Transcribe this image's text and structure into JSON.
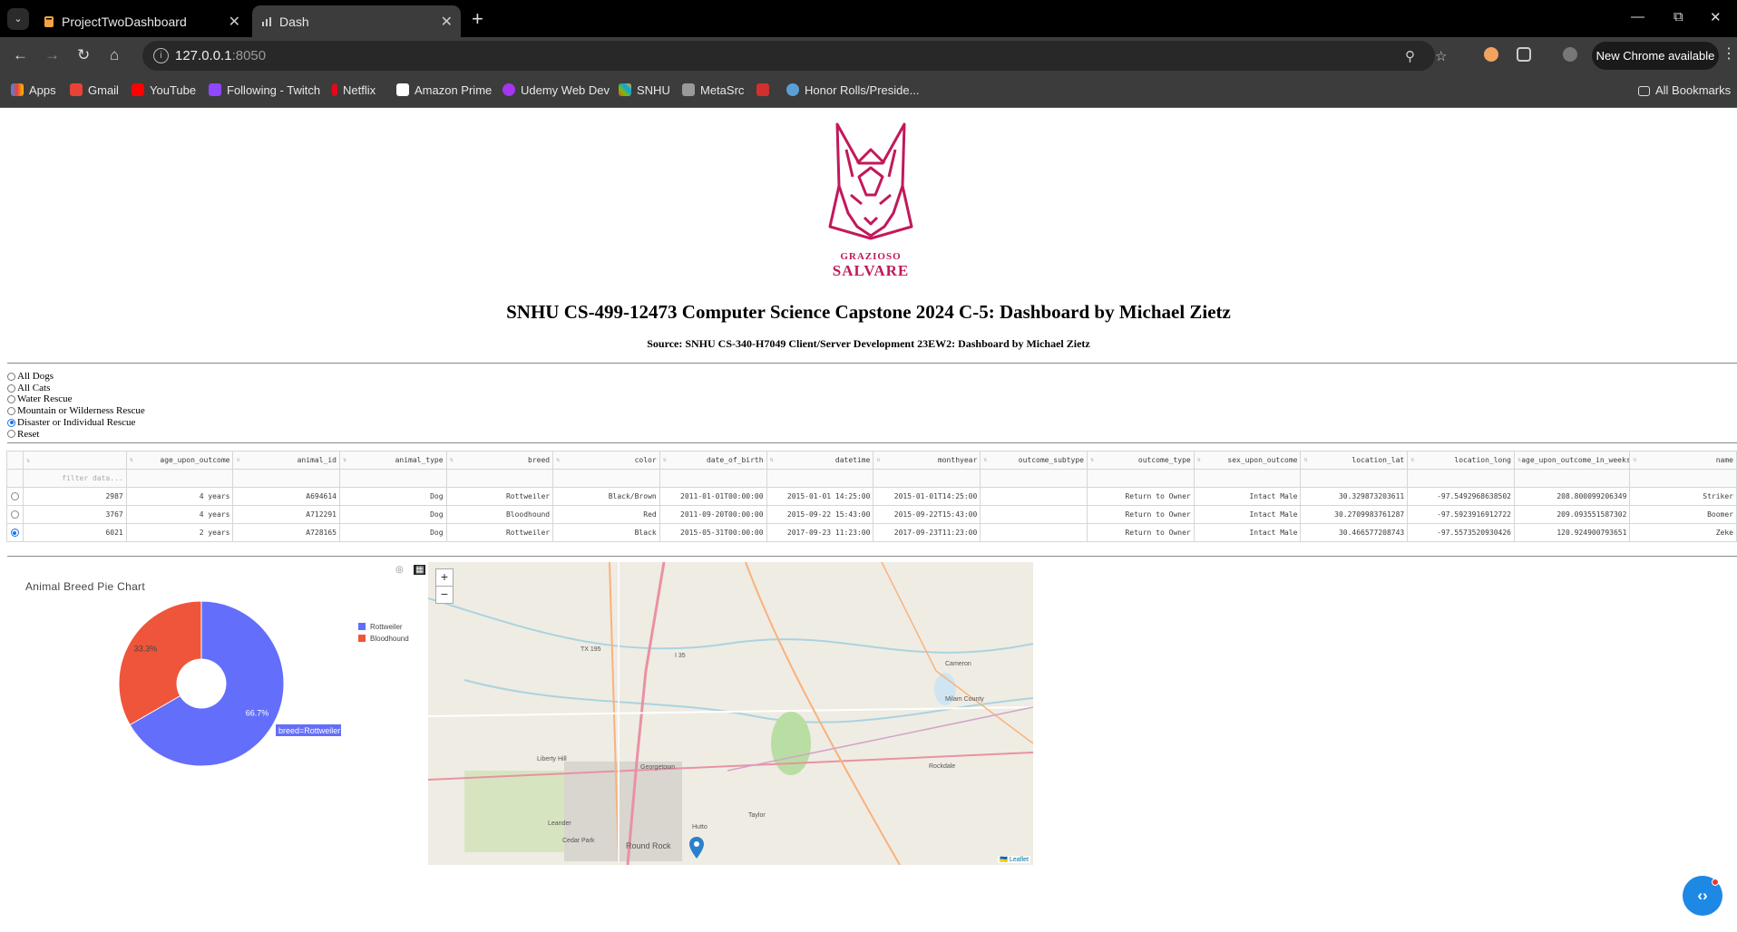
{
  "browser": {
    "tabs": [
      {
        "title": "ProjectTwoDashboard",
        "active": false
      },
      {
        "title": "Dash",
        "active": true
      }
    ],
    "url_host": "127.0.0.1",
    "url_port": ":8050",
    "new_chrome": "New Chrome available",
    "bookmarks": [
      "Apps",
      "Gmail",
      "YouTube",
      "Following - Twitch",
      "Netflix",
      "Amazon Prime",
      "Udemy Web Dev",
      "SNHU",
      "MetaSrc",
      "",
      "Honor Rolls/Preside..."
    ],
    "all_bookmarks": "All Bookmarks"
  },
  "header": {
    "brand_small": "GRAZIOSO",
    "brand_large": "SALVARE",
    "title": "SNHU CS-499-12473 Computer Science Capstone 2024 C-5: Dashboard by Michael Zietz",
    "subtitle": "Source: SNHU CS-340-H7049 Client/Server Development 23EW2: Dashboard by Michael Zietz"
  },
  "filters": {
    "options": [
      "All Dogs",
      "All Cats",
      "Water Rescue",
      "Mountain or Wilderness Rescue",
      "Disaster or Individual Rescue",
      "Reset"
    ],
    "selected": "Disaster or Individual Rescue"
  },
  "table": {
    "columns": [
      "",
      "age_upon_outcome",
      "animal_id",
      "animal_type",
      "breed",
      "color",
      "date_of_birth",
      "datetime",
      "monthyear",
      "outcome_subtype",
      "outcome_type",
      "sex_upon_outcome",
      "location_lat",
      "location_long",
      "age_upon_outcome_in_weeks",
      "name"
    ],
    "filter_placeholder": "filter data...",
    "rows": [
      {
        "selected": false,
        "cells": [
          "2987",
          "4 years",
          "A694614",
          "Dog",
          "Rottweiler",
          "Black/Brown",
          "2011-01-01T00:00:00",
          "2015-01-01 14:25:00",
          "2015-01-01T14:25:00",
          "",
          "Return to Owner",
          "Intact Male",
          "30.329873203611",
          "-97.549296863850​2",
          "208.800099206349",
          "Striker"
        ]
      },
      {
        "selected": false,
        "cells": [
          "3767",
          "4 years",
          "A712291",
          "Dog",
          "Bloodhound",
          "Red",
          "2011-09-20T00:00:00",
          "2015-09-22 15:43:00",
          "2015-09-22T15:43:00",
          "",
          "Return to Owner",
          "Intact Male",
          "30.2709983761287",
          "-97.5923916912722",
          "209.093551587302",
          "Boomer"
        ]
      },
      {
        "selected": true,
        "cells": [
          "6021",
          "2 years",
          "A728165",
          "Dog",
          "Rottweiler",
          "Black",
          "2015-05-31T00:00:00",
          "2017-09-23 11:23:00",
          "2017-09-23T11:23:00",
          "",
          "Return to Owner",
          "Intact Male",
          "30.466577208743",
          "-97.5573520930426",
          "120.924900793651",
          "Zeke"
        ]
      }
    ]
  },
  "chart_data": {
    "type": "pie",
    "title": "Animal Breed Pie Chart",
    "hole": true,
    "categories": [
      "Rottweiler",
      "Bloodhound"
    ],
    "values": [
      2,
      1
    ],
    "labels": [
      "66.7%",
      "33.3%"
    ],
    "colors": [
      "#636efa",
      "#ef553b"
    ],
    "hover_label": "breed=Rottweiler",
    "legend_position": "top-right"
  },
  "map": {
    "zoom_in": "+",
    "zoom_out": "−",
    "attribution": "Leaflet",
    "places": [
      "Round Rock",
      "Georgetown",
      "Liberty Hill",
      "Leander",
      "Cedar Park",
      "Hutto",
      "Taylor",
      "Rockdale",
      "Cameron",
      "Milam County",
      "TX 195",
      "I 35"
    ],
    "marker_icon": "map-pin-icon"
  }
}
